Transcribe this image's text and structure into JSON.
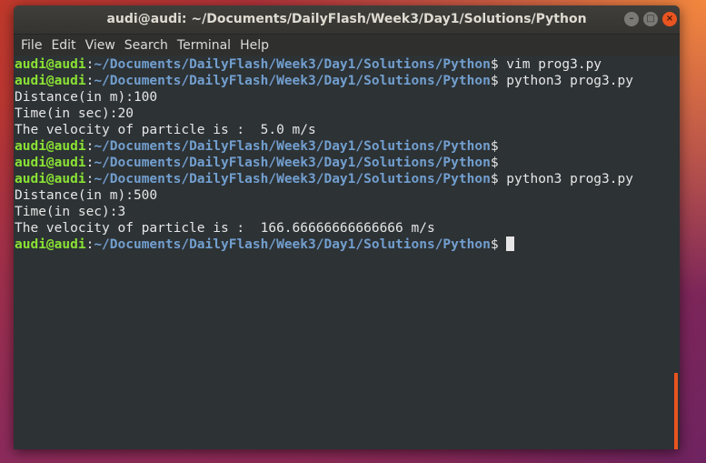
{
  "window": {
    "title": "audi@audi: ~/Documents/DailyFlash/Week3/Day1/Solutions/Python",
    "controls": {
      "minimize": "–",
      "maximize": "□",
      "close": "×"
    }
  },
  "menu": [
    "File",
    "Edit",
    "View",
    "Search",
    "Terminal",
    "Help"
  ],
  "terminal": {
    "prompt_user": "audi@audi",
    "prompt_colon": ":",
    "prompt_path": "~/Documents/DailyFlash/Week3/Day1/Solutions/Python",
    "prompt_sign": "$",
    "lines": [
      {
        "type": "prompt",
        "cmd": " vim prog3.py"
      },
      {
        "type": "prompt",
        "cmd": " python3 prog3.py"
      },
      {
        "type": "output",
        "text": "Distance(in m):100"
      },
      {
        "type": "output",
        "text": "Time(in sec):20"
      },
      {
        "type": "output",
        "text": "The velocity of particle is :  5.0 m/s"
      },
      {
        "type": "prompt",
        "cmd": ""
      },
      {
        "type": "prompt",
        "cmd": ""
      },
      {
        "type": "prompt",
        "cmd": " python3 prog3.py"
      },
      {
        "type": "output",
        "text": "Distance(in m):500"
      },
      {
        "type": "output",
        "text": "Time(in sec):3"
      },
      {
        "type": "output",
        "text": "The velocity of particle is :  166.66666666666666 m/s"
      },
      {
        "type": "prompt",
        "cmd": " ",
        "cursor": true
      }
    ]
  },
  "colors": {
    "prompt_user": "#8ae234",
    "prompt_path": "#729fcf",
    "terminal_bg": "#2d3235",
    "accent": "#e95420"
  }
}
